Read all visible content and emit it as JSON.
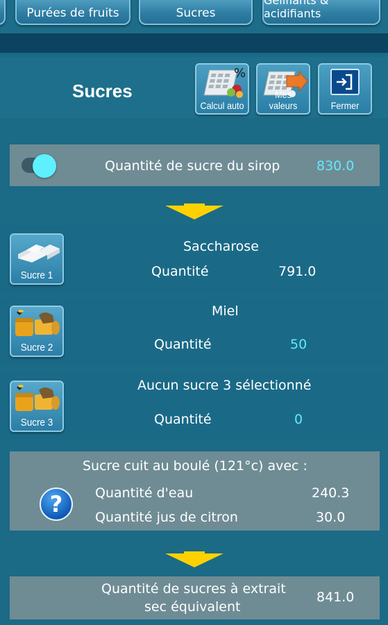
{
  "tabs": [
    {
      "label": "Purées de fruits"
    },
    {
      "label": "Sucres"
    },
    {
      "label": "Gélifiants & acidifiants"
    }
  ],
  "header": {
    "title": "Sucres",
    "buttons": [
      {
        "label": "Calcul auto",
        "icon": "calculator-fruit-icon"
      },
      {
        "label": "Mes valeurs",
        "icon": "calculator-arrow-icon"
      },
      {
        "label": "Fermer",
        "icon": "exit-icon"
      }
    ]
  },
  "syrup": {
    "toggle_on": true,
    "label": "Quantité de sucre du sirop",
    "value": "830.0"
  },
  "sugars": [
    {
      "button": "Sucre 1",
      "name": "Saccharose",
      "qty_label": "Quantité",
      "qty": "791.0",
      "icon": "sugar-cubes-icon"
    },
    {
      "button": "Sucre 2",
      "name": "Miel",
      "qty_label": "Quantité",
      "qty": "50",
      "icon": "honey-icon"
    },
    {
      "button": "Sucre 3",
      "name": "Aucun sucre 3 sélectionné",
      "qty_label": "Quantité",
      "qty": "0",
      "icon": "honey-icon"
    }
  ],
  "cooking": {
    "title": "Sucre cuit au boulé (121°c) avec :",
    "water_label": "Quantité d'eau",
    "water_value": "240.3",
    "lemon_label": "Quantité jus de citron",
    "lemon_value": "30.0"
  },
  "total": {
    "label_line1": "Quantité de sucres à extrait",
    "label_line2": "sec équivalent",
    "value": "841.0"
  },
  "colors": {
    "background": "#1b6a86",
    "accent_cyan": "#63e8ff",
    "arrow_yellow": "#ffd100",
    "panel_gray": "#6f8c95"
  }
}
